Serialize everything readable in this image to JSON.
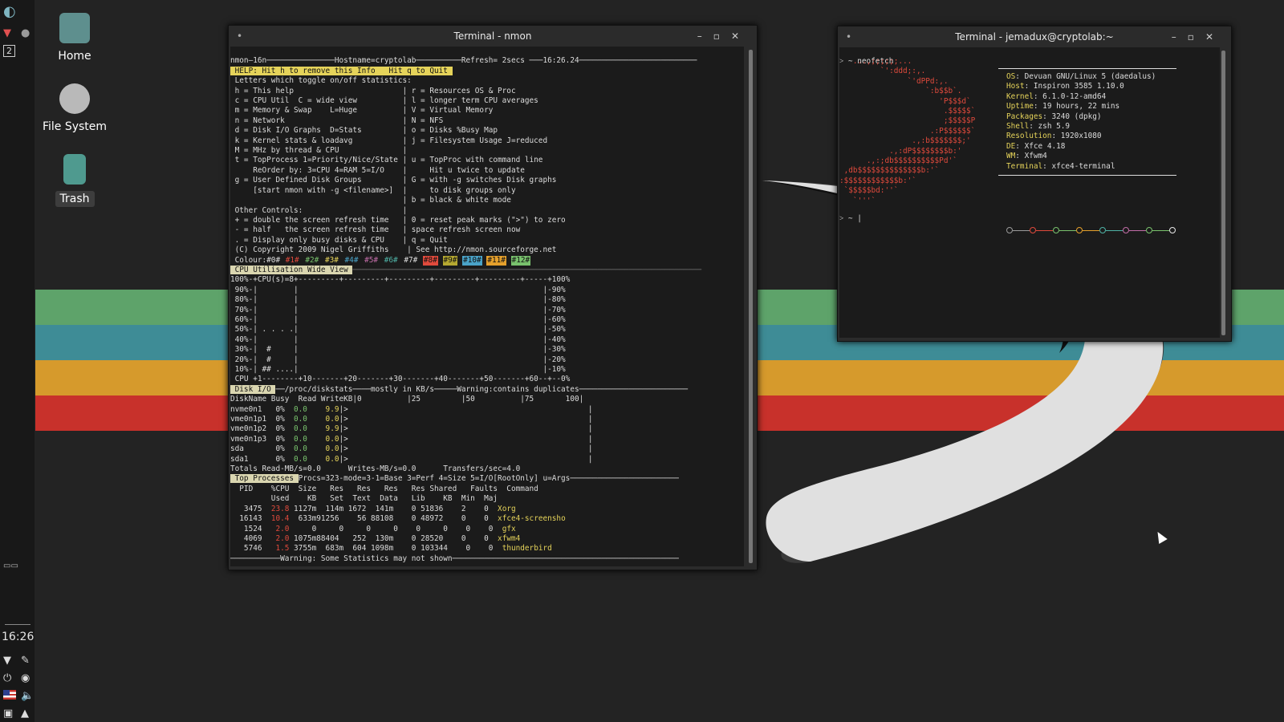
{
  "desktop": {
    "icons": [
      {
        "label": "Home",
        "icon": "home-folder-icon"
      },
      {
        "label": "File System",
        "icon": "drive-icon"
      },
      {
        "label": "Trash",
        "icon": "trash-icon"
      }
    ],
    "stripe_colors": [
      "#5ea36a",
      "#3e8c96",
      "#d69a2c",
      "#c8312b"
    ]
  },
  "panel": {
    "workspace": "2",
    "clock": "16:26"
  },
  "nmon": {
    "title": "Terminal - nmon",
    "header": "nmon–16n───────────────Hostname=cryptolab──────────Refresh= 2secs ───16:26.24──────────────────────────",
    "help_title": " HELP: Hit h to remove this Info   Hit q to Quit ",
    "help_lines": [
      " Letters which toggle on/off statistics:",
      " h = This help                        | r = Resources OS & Proc",
      " c = CPU Util  C = wide view          | l = longer term CPU averages",
      " m = Memory & Swap    L=Huge          | V = Virtual Memory",
      " n = Network                          | N = NFS",
      " d = Disk I/O Graphs  D=Stats         | o = Disks %Busy Map",
      " k = Kernel stats & loadavg           | j = Filesystem Usage J=reduced",
      " M = MHz by thread & CPU              |",
      " t = TopProcess 1=Priority/Nice/State | u = TopProc with command line",
      "     ReOrder by: 3=CPU 4=RAM 5=I/O    |     Hit u twice to update",
      " g = User Defined Disk Groups         | G = with -g switches Disk graphs",
      "     [start nmon with -g <filename>]  |     to disk groups only",
      "                                      | b = black & white mode",
      " Other Controls:                      |",
      " + = double the screen refresh time   | 0 = reset peak marks (\">\") to zero",
      " - = half   the screen refresh time   | space refresh screen now",
      " . = Display only busy disks & CPU    | q = Quit",
      "",
      " (C) Copyright 2009 Nigel Griffiths    | See http://nmon.sourceforge.net"
    ],
    "colour_label": " Colour:#0#",
    "colour_cells": [
      {
        "text": "#1#",
        "color": "#e04a3c",
        "bg": ""
      },
      {
        "text": "#2#",
        "color": "#79c26d",
        "bg": ""
      },
      {
        "text": "#3#",
        "color": "#e5d35a",
        "bg": ""
      },
      {
        "text": "#4#",
        "color": "#4aa3c8",
        "bg": ""
      },
      {
        "text": "#5#",
        "color": "#c26da8",
        "bg": ""
      },
      {
        "text": "#6#",
        "color": "#4fb3a6",
        "bg": ""
      },
      {
        "text": "#7#",
        "color": "#dcdcdc",
        "bg": ""
      },
      {
        "text": "#8#",
        "color": "#111111",
        "bg": "#e04a3c"
      },
      {
        "text": "#9#",
        "color": "#111111",
        "bg": "#b5a831"
      },
      {
        "text": "#10#",
        "color": "#111111",
        "bg": "#4aa3c8"
      },
      {
        "text": "#11#",
        "color": "#111111",
        "bg": "#e5a02c"
      },
      {
        "text": "#12#",
        "color": "#111111",
        "bg": "#79c26d"
      }
    ],
    "cpu_title": " CPU Utilisation Wide View ",
    "cpu_lines": [
      "100%-+CPU(s)=8+---------+---------+---------+---------+---------+-----+100%",
      " 90%-|        |                                                      |-90%",
      " 80%-|        |                                                      |-80%",
      " 70%-|        |                                                      |-70%",
      " 60%-|        |                                                      |-60%",
      " 50%-| . . . .|                                                      |-50%",
      " 40%-|        |                                                      |-40%",
      " 30%-|  #     |                                                      |-30%",
      " 20%-|  #     |                                                      |-20%",
      " 10%-| ## ....|                                                      |-10%",
      " CPU +1--------+10-------+20-------+30-------+40-------+50-------+60--+--0%"
    ],
    "disk_title": " Disk I/O ",
    "disk_header_rest": "──/proc/diskstats────mostly in KB/s─────Warning:contains duplicates────────────────────────",
    "disk_cols": "DiskName Busy  Read WriteKB|0          |25         |50          |75       100|",
    "disks": [
      {
        "name": "nvme0n1 ",
        "busy": "  0%",
        "read": "  0.0",
        "write": "  9.9"
      },
      {
        "name": "vme0n1p1",
        "busy": "  0%",
        "read": "  0.0",
        "write": "  0.0"
      },
      {
        "name": "vme0n1p2",
        "busy": "  0%",
        "read": "  0.0",
        "write": "  9.9"
      },
      {
        "name": "vme0n1p3",
        "busy": "  0%",
        "read": "  0.0",
        "write": "  0.0"
      },
      {
        "name": "sda     ",
        "busy": "  0%",
        "read": "  0.0",
        "write": "  0.0"
      },
      {
        "name": "sda1    ",
        "busy": "  0%",
        "read": "  0.0",
        "write": "  0.0"
      }
    ],
    "disk_totals": "Totals Read-MB/s=0.0      Writes-MB/s=0.0      Transfers/sec=4.0",
    "top_title": " Top Processes ",
    "top_header_rest": "Procs=323-mode=3-1=Base 3=Perf 4=Size 5=I/O[RootOnly] u=Args────────────────────────",
    "top_cols1": "  PID    %CPU  Size   Res   Res   Res   Res Shared   Faults  Command",
    "top_cols2": "         Used    KB   Set  Text  Data   Lib    KB  Min  Maj",
    "procs": [
      {
        "pid": "   3475",
        "cpu": "23.8",
        "rest": " 1127m  114m 1672  141m    0 51836    2    0",
        "cmd": "Xorg"
      },
      {
        "pid": "  16143",
        "cpu": "10.4",
        "rest": "  633m91256    56 88108    0 48972    0    0",
        "cmd": "xfce4-screensho"
      },
      {
        "pid": "   1524",
        "cpu": " 2.0",
        "rest": "     0     0     0     0    0     0    0    0",
        "cmd": "gfx"
      },
      {
        "pid": "   4069",
        "cpu": " 2.0",
        "rest": " 1075m88404   252  130m    0 28520    0    0",
        "cmd": "xfwm4"
      },
      {
        "pid": "   5746",
        "cpu": " 1.5",
        "rest": " 3755m  683m  604 1098m    0 103344    0    0",
        "cmd": "thunderbird"
      }
    ],
    "footer": "───────────Warning: Some Statistics may not shown──────────────────────────────────────────────────"
  },
  "neofetch": {
    "title": "Terminal - jemadux@cryptolab:~",
    "prompt1": "˃ ~ neofetch",
    "ascii": [
      "   ...,;;;;;;...",
      "         `':ddd;:,.",
      "               `'dPPd:,.",
      "                   `:b$$b`.",
      "                      'P$$$d`",
      "                       .$$$$$`",
      "                       ;$$$$$P",
      "                    .:P$$$$$$`",
      "                .,:b$$$$$$$;'",
      "           .,:dP$$$$$$$$b:'",
      "      .,:;db$$$$$$$$$$Pd'`",
      " ,db$$$$$$$$$$$$$$b:'`",
      ":$$$$$$$$$$$$b:'`",
      " `$$$$$bd:''`",
      "   `'''`"
    ],
    "info": [
      {
        "key": "OS",
        "value": "Devuan GNU/Linux 5 (daedalus)"
      },
      {
        "key": "Host",
        "value": "Inspiron 3585 1.10.0"
      },
      {
        "key": "Kernel",
        "value": "6.1.0-12-amd64"
      },
      {
        "key": "Uptime",
        "value": "19 hours, 22 mins"
      },
      {
        "key": "Packages",
        "value": "3240 (dpkg)"
      },
      {
        "key": "Shell",
        "value": "zsh 5.9"
      },
      {
        "key": "Resolution",
        "value": "1920x1080"
      },
      {
        "key": "DE",
        "value": "Xfce 4.18"
      },
      {
        "key": "WM",
        "value": "Xfwm4"
      },
      {
        "key": "Terminal",
        "value": "xfce4-terminal"
      }
    ],
    "palette_colors": [
      "#9a9a9a",
      "#e04a3c",
      "#79c26d",
      "#e5a02c",
      "#4fb3a6",
      "#c26da8",
      "#79c26d",
      "#e8e8e8"
    ],
    "prompt2": "˃ ~ |"
  }
}
